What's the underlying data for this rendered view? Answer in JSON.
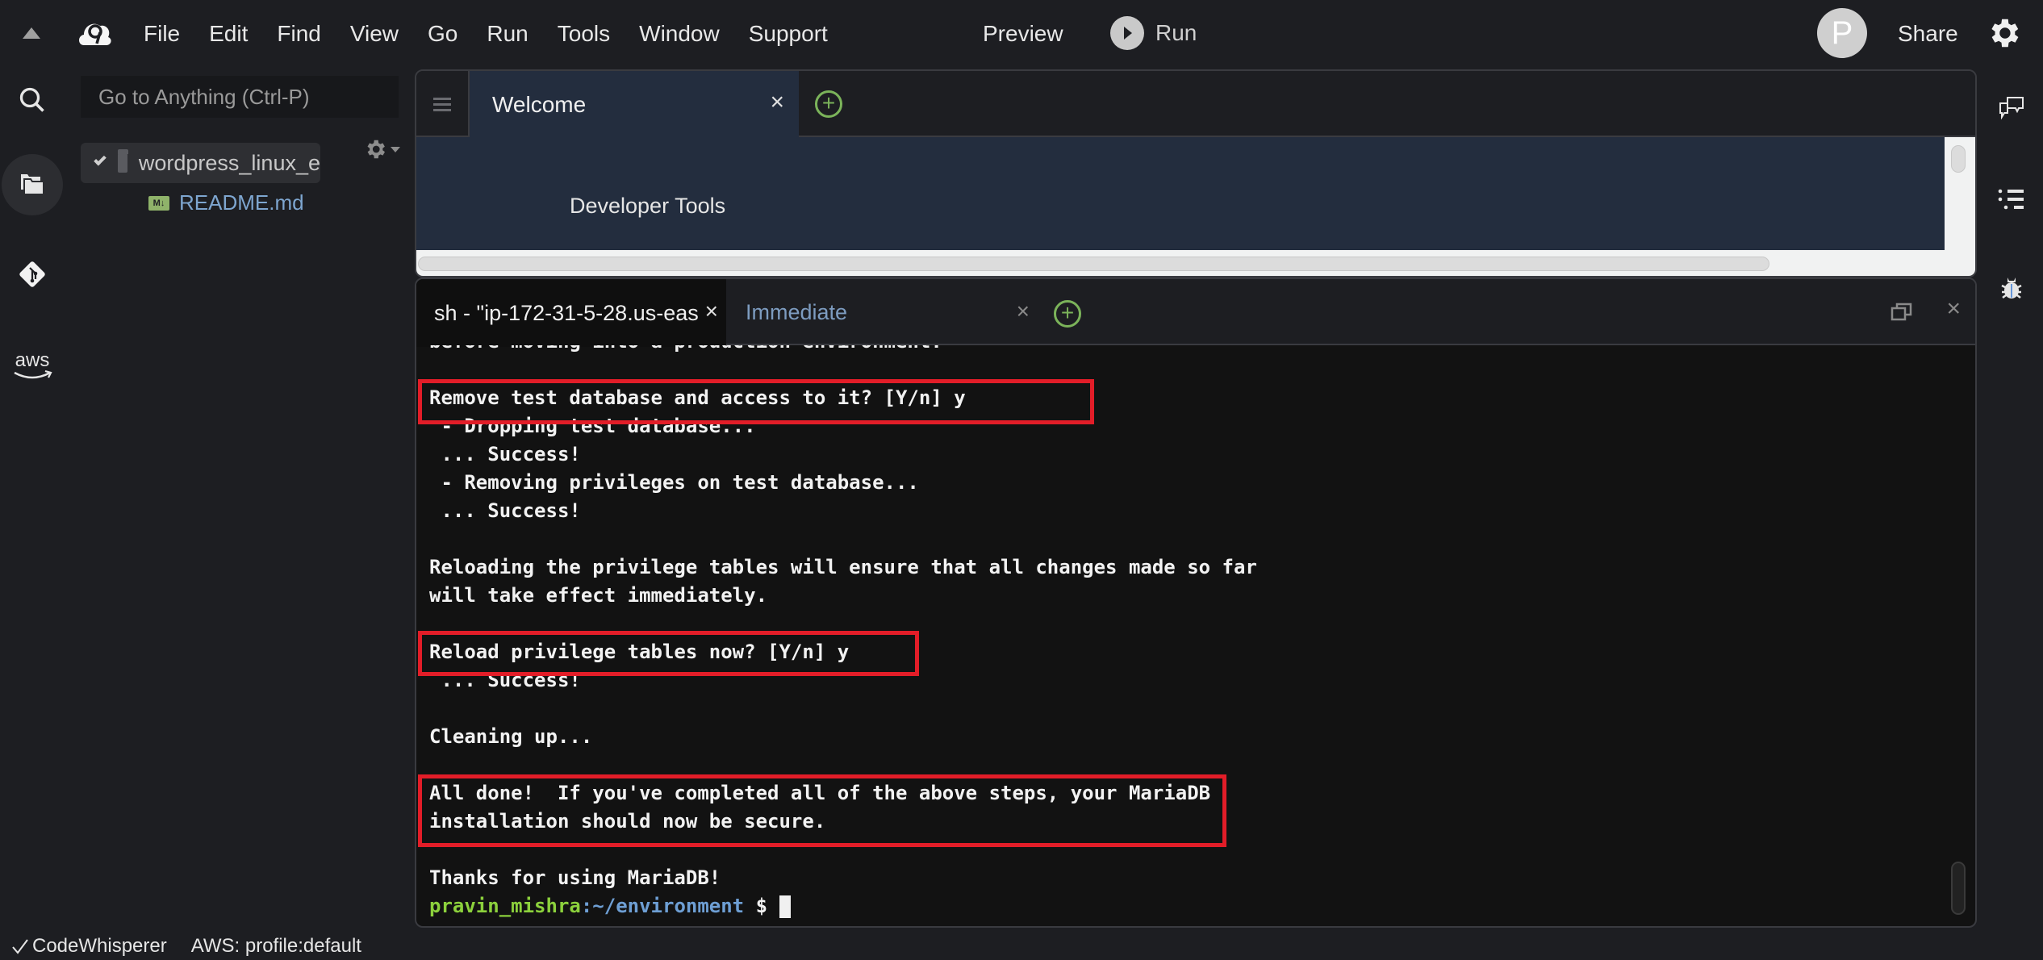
{
  "menubar": {
    "items": [
      "File",
      "Edit",
      "Find",
      "View",
      "Go",
      "Run",
      "Tools",
      "Window",
      "Support"
    ],
    "preview_label": "Preview",
    "run_label": "Run",
    "avatar_initial": "P",
    "share_label": "Share"
  },
  "sidebar": {
    "goto_placeholder": "Go to Anything (Ctrl-P)",
    "tree_root": "wordpress_linux_e",
    "tree_files": [
      {
        "name": "README.md",
        "badge": "M↓"
      }
    ],
    "rail_icons": [
      "search-icon",
      "files-icon",
      "git-icon",
      "aws-icon"
    ],
    "aws_label": "aws"
  },
  "editor": {
    "tabs": [
      {
        "label": "Welcome",
        "active": true
      }
    ],
    "content_heading": "Developer Tools"
  },
  "terminal": {
    "tabs": [
      {
        "label": "sh - \"ip-172-31-5-28.us-eas",
        "active": true
      },
      {
        "label": "Immediate",
        "active": false
      }
    ],
    "lines": [
      "before moving into a production environment.",
      "",
      "Remove test database and access to it? [Y/n] y",
      " - Dropping test database...",
      " ... Success!",
      " - Removing privileges on test database...",
      " ... Success!",
      "",
      "Reloading the privilege tables will ensure that all changes made so far",
      "will take effect immediately.",
      "",
      "Reload privilege tables now? [Y/n] y",
      " ... Success!",
      "",
      "Cleaning up...",
      "",
      "All done!  If you've completed all of the above steps, your MariaDB",
      "installation should now be secure.",
      "",
      "Thanks for using MariaDB!"
    ],
    "prompt": {
      "user": "pravin_mishra",
      "path": ":~/environment",
      "symbol": " $ "
    },
    "highlight_color": "#e21d28"
  },
  "statusbar": {
    "codewhisperer": "CodeWhisperer",
    "aws_profile": "AWS: profile:default"
  },
  "colors": {
    "background": "#1d1e22",
    "editor_bg": "#232d3e",
    "terminal_bg": "#121212",
    "accent_green": "#7bb35a",
    "prompt_user": "#8cd13c",
    "prompt_path": "#6e9fd4"
  }
}
